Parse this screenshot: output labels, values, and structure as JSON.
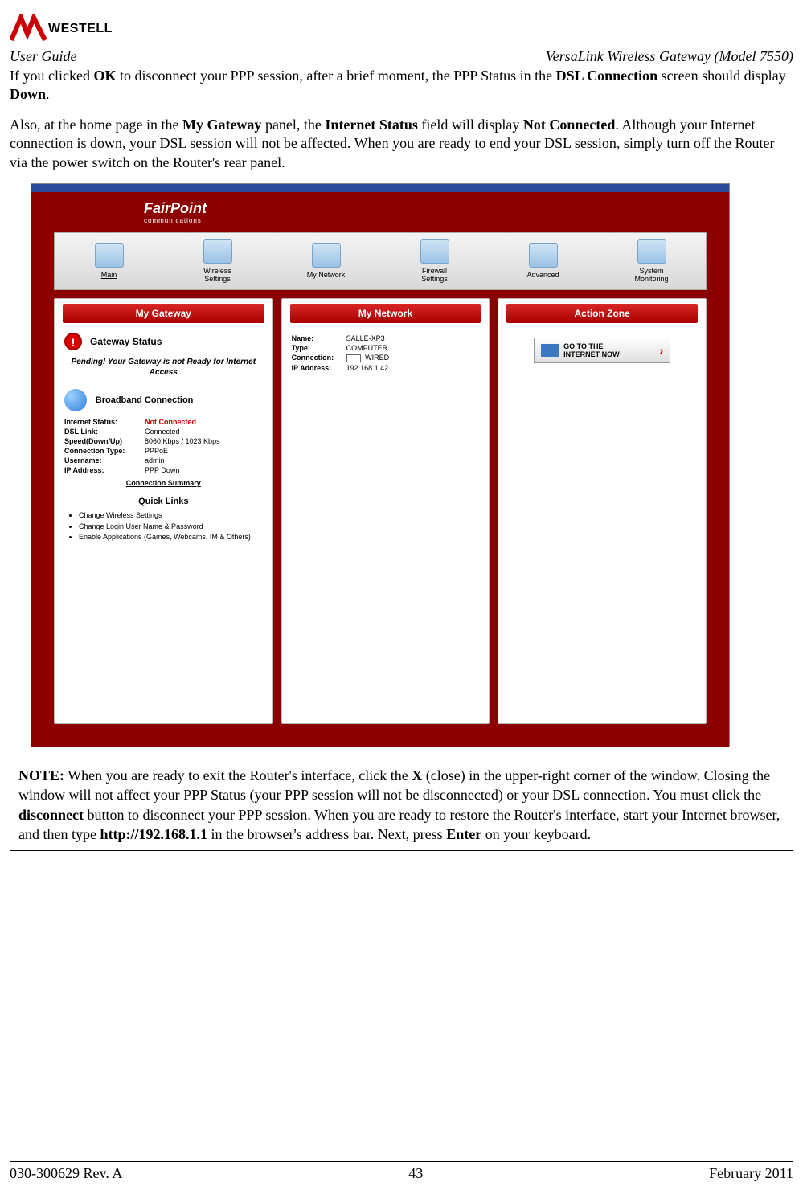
{
  "brand": "WESTELL",
  "header": {
    "left": "User Guide",
    "right": "VersaLink Wireless Gateway (Model 7550)"
  },
  "para1_parts": [
    "If you clicked ",
    "OK",
    " to disconnect your PPP session, after a brief moment, the PPP Status in the ",
    "DSL Connection",
    " screen should display ",
    "Down",
    "."
  ],
  "para2_parts": [
    "Also, at the home page in the ",
    "My Gateway",
    " panel, the ",
    "Internet Status",
    " field will display ",
    "Not Connected",
    ". Although your Internet connection is down, your DSL session will not be affected. When you are ready to end your DSL session, simply turn off the Router via the power switch on the Router's rear panel."
  ],
  "screenshot": {
    "isp_logo": {
      "line1": "FairPoint",
      "line2": "communications"
    },
    "nav": [
      {
        "label": "Main"
      },
      {
        "label": "Wireless\nSettings"
      },
      {
        "label": "My Network"
      },
      {
        "label": "Firewall\nSettings"
      },
      {
        "label": "Advanced"
      },
      {
        "label": "System\nMonitoring"
      }
    ],
    "panel_gateway": {
      "title": "My Gateway",
      "status_heading": "Gateway Status",
      "pending": "Pending! Your Gateway is not Ready for Internet Access",
      "bb_heading": "Broadband Connection",
      "kv": [
        {
          "k": "Internet Status:",
          "v": "Not Connected",
          "red": true
        },
        {
          "k": "DSL Link:",
          "v": "Connected"
        },
        {
          "k": "Speed(Down/Up)",
          "v": "8060 Kbps / 1023 Kbps"
        },
        {
          "k": "Connection Type:",
          "v": "PPPoE"
        },
        {
          "k": "Username:",
          "v": "admin"
        },
        {
          "k": "IP Address:",
          "v": "PPP Down"
        }
      ],
      "summary_link": "Connection Summary",
      "ql_title": "Quick Links",
      "ql_items": [
        "Change Wireless Settings",
        "Change Login User Name & Password",
        "Enable Applications  (Games, Webcams, IM & Others)"
      ]
    },
    "panel_network": {
      "title": "My Network",
      "device": {
        "name_l": "Name:",
        "name_v": "SALLE-XP3",
        "type_l": "Type:",
        "type_v": "COMPUTER",
        "conn_l": "Connection:",
        "conn_v": "WIRED",
        "ip_l": "IP Address:",
        "ip_v": "192.168.1.42"
      }
    },
    "panel_action": {
      "title": "Action Zone",
      "button_line1": "GO TO THE",
      "button_line2": "INTERNET NOW"
    }
  },
  "note_parts": [
    "NOTE:",
    "  When you are ready to exit the Router's interface, click the ",
    "X",
    " (close) in the upper-right corner of the window. Closing the window will not affect your PPP Status (your PPP session will not be disconnected) or your DSL connection. You must click the ",
    "disconnect",
    " button to disconnect your PPP session. When you are ready to restore the Router's interface, start your Internet browser, and then type ",
    "http://192.168.1.1",
    " in the browser's address bar. Next, press ",
    "Enter",
    " on your keyboard."
  ],
  "footer": {
    "left": "030-300629 Rev. A",
    "center": "43",
    "right": "February 2011"
  }
}
